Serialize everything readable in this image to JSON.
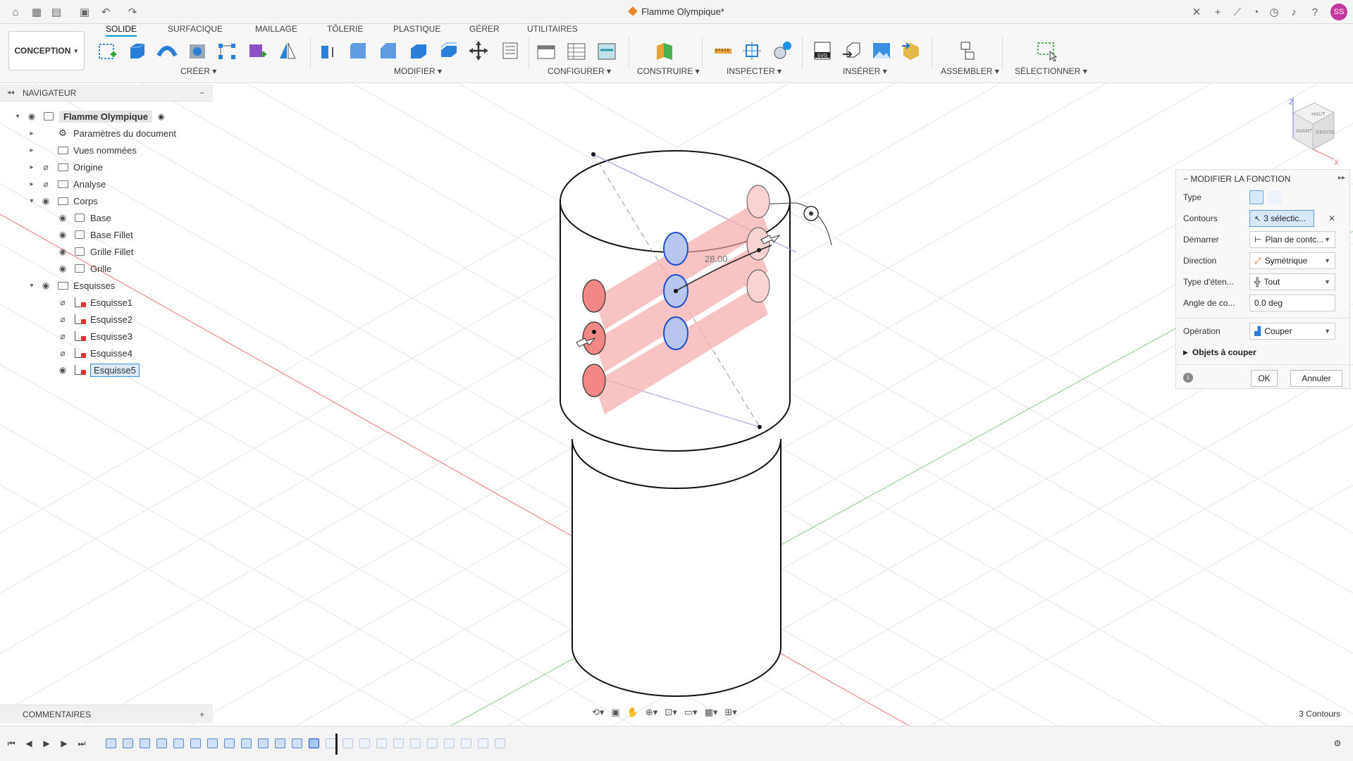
{
  "window": {
    "title": "Flamme Olympique*",
    "user_initials": "SS"
  },
  "ribbon": {
    "workspace": "CONCEPTION",
    "tabs": [
      "SOLIDE",
      "SURFACIQUE",
      "MAILLAGE",
      "TÔLERIE",
      "PLASTIQUE",
      "GÉRER",
      "UTILITAIRES"
    ],
    "active_tab": "SOLIDE",
    "groups": [
      "CRÉER",
      "MODIFIER",
      "CONFIGURER",
      "CONSTRUIRE",
      "INSPECTER",
      "INSÉRER",
      "ASSEMBLER",
      "SÉLECTIONNER"
    ]
  },
  "navigator": {
    "title": "NAVIGATEUR",
    "items": [
      {
        "label": "Flamme Olympique",
        "level": 0,
        "icon": "document-icon",
        "expanded": true
      },
      {
        "label": "Paramètres du document",
        "level": 1,
        "icon": "gear-icon"
      },
      {
        "label": "Vues nommées",
        "level": 1,
        "icon": "folder-icon"
      },
      {
        "label": "Origine",
        "level": 1,
        "icon": "folder-icon",
        "hidden": true
      },
      {
        "label": "Analyse",
        "level": 1,
        "icon": "folder-icon",
        "hidden": true
      },
      {
        "label": "Corps",
        "level": 1,
        "icon": "folder-icon",
        "expanded": true
      },
      {
        "label": "Base",
        "level": 2,
        "icon": "body-icon"
      },
      {
        "label": "Base Fillet",
        "level": 2,
        "icon": "body-icon"
      },
      {
        "label": "Grille Fillet",
        "level": 2,
        "icon": "body-icon"
      },
      {
        "label": "Grille",
        "level": 2,
        "icon": "body-icon"
      },
      {
        "label": "Esquisses",
        "level": 1,
        "icon": "folder-icon",
        "expanded": true
      },
      {
        "label": "Esquisse1",
        "level": 2,
        "icon": "sketch-icon",
        "hidden": true
      },
      {
        "label": "Esquisse2",
        "level": 2,
        "icon": "sketch-icon",
        "hidden": true
      },
      {
        "label": "Esquisse3",
        "level": 2,
        "icon": "sketch-icon",
        "hidden": true
      },
      {
        "label": "Esquisse4",
        "level": 2,
        "icon": "sketch-icon",
        "hidden": true
      },
      {
        "label": "Esquisse5",
        "level": 2,
        "icon": "sketch-icon",
        "selected": true
      }
    ]
  },
  "viewport": {
    "dimension_label": "28.00",
    "viewcube": {
      "top": "HAUT",
      "front": "AVANT",
      "right": "DROITE",
      "axis_z": "Z",
      "axis_x": "X"
    }
  },
  "panel": {
    "title": "MODIFIER LA FONCTION",
    "type_label": "Type",
    "contours_label": "Contours",
    "contours_value": "3 sélectic...",
    "start_label": "Démarrer",
    "start_value": "Plan de contc...",
    "direction_label": "Direction",
    "direction_value": "Symétrique",
    "extent_label": "Type d'éten...",
    "extent_value": "Tout",
    "angle_label": "Angle de co...",
    "angle_value": "0.0 deg",
    "operation_label": "Opération",
    "operation_value": "Couper",
    "objects_label": "Objets à couper",
    "ok": "OK",
    "cancel": "Annuler"
  },
  "bottom": {
    "comments": "COMMENTAIRES",
    "status": "3 Contours"
  }
}
